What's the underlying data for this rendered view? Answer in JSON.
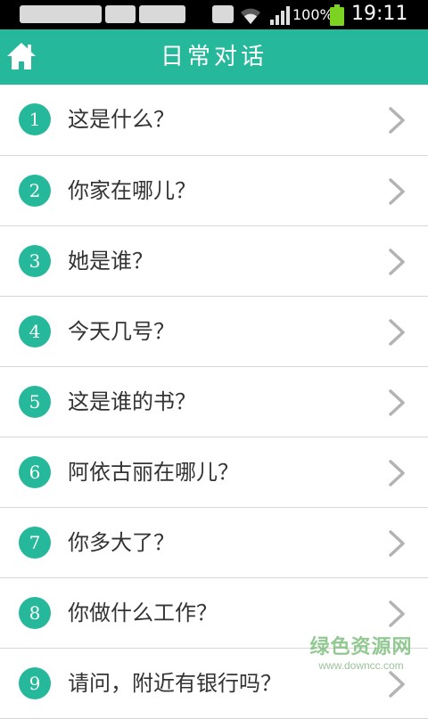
{
  "status_bar": {
    "battery_percent": "100%",
    "time": "19:11",
    "battery_color": "#7cd321"
  },
  "header": {
    "title": "日常对话",
    "home_icon": "home-icon",
    "background": "#26b89b"
  },
  "list": {
    "items": [
      {
        "number": "1",
        "label": "这是什么？"
      },
      {
        "number": "2",
        "label": "你家在哪儿？"
      },
      {
        "number": "3",
        "label": "她是谁？"
      },
      {
        "number": "4",
        "label": "今天几号？"
      },
      {
        "number": "5",
        "label": "这是谁的书？"
      },
      {
        "number": "6",
        "label": "阿依古丽在哪儿？"
      },
      {
        "number": "7",
        "label": "你多大了？"
      },
      {
        "number": "8",
        "label": "你做什么工作？"
      },
      {
        "number": "9",
        "label": "请问，附近有银行吗？"
      }
    ],
    "badge_color": "#26b89b",
    "chevron_icon": "chevron-right-icon"
  },
  "watermark": {
    "main": "绿色资源网",
    "sub": "www.downcc.com"
  }
}
